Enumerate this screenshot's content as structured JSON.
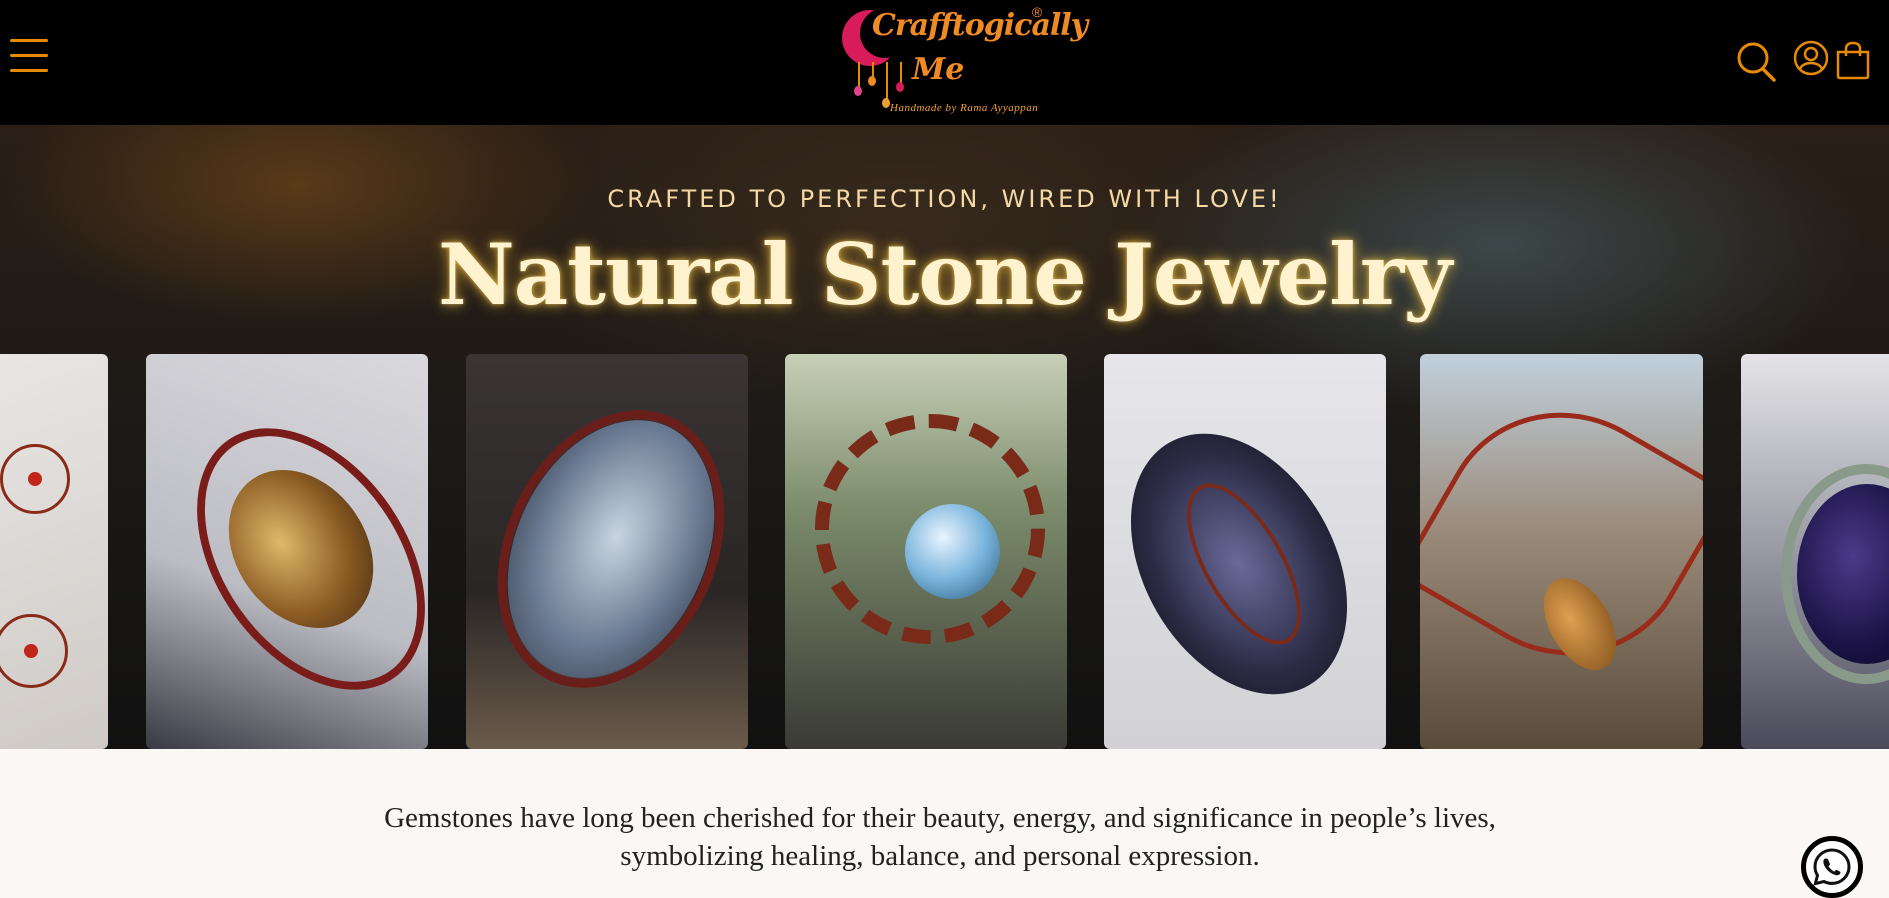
{
  "header": {
    "menu_icon": "hamburger-menu-icon",
    "logo": {
      "brand": "Crafftogically Me",
      "tagline": "Handmade by Rama Ayyappan",
      "registered_mark": "®"
    },
    "icons": [
      "search-icon",
      "account-icon",
      "cart-icon"
    ],
    "accent_color": "#e68a00"
  },
  "hero": {
    "eyebrow": "CRAFTED TO PERFECTION, WIRED WITH LOVE!",
    "title": "Natural Stone Jewelry",
    "gallery_items": [
      "copper wire flower earrings",
      "tiger eye wire wrapped pendant",
      "labradorite tree of life pendant",
      "labradorite sun pendant",
      "druzy tree of life pendant",
      "copper leaf pendant",
      "blue stone silver wire pendant"
    ]
  },
  "intro": {
    "text": "Gemstones have long been cherished for their beauty, energy, and significance in people’s lives, symbolizing healing, balance, and personal expression."
  },
  "floating": {
    "whatsapp_icon": "whatsapp-icon",
    "whatsapp_color": "#1faa3c"
  }
}
